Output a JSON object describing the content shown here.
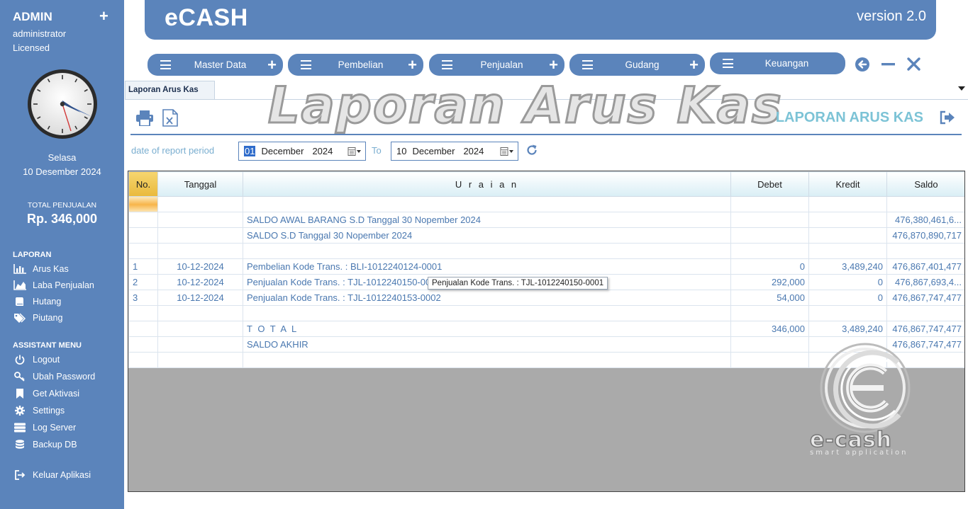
{
  "sidebar": {
    "admin": "ADMIN",
    "user": "administrator",
    "license": "Licensed",
    "day": "Selasa",
    "date": "10 Desember 2024",
    "total_label": "TOTAL PENJUALAN",
    "total_value": "Rp. 346,000",
    "laporan_title": "LAPORAN",
    "laporan_items": [
      "Arus Kas",
      "Laba Penjualan",
      "Hutang",
      "Piutang"
    ],
    "assistant_title": "ASSISTANT MENU",
    "assistant_items": [
      "Logout",
      "Ubah Password",
      "Get Aktivasi",
      "Settings",
      "Log Server",
      "Backup DB"
    ],
    "exit": "Keluar Aplikasi"
  },
  "header": {
    "title": "eCASH",
    "version": "version 2.0"
  },
  "menu": [
    "Master Data",
    "Pembelian",
    "Penjualan",
    "Gudang",
    "Keuangan"
  ],
  "tab": {
    "label": "Laporan Arus Kas"
  },
  "watermark": "Laporan Arus Kas",
  "report": {
    "title": "LAPORAN ARUS KAS"
  },
  "period": {
    "label": "date of report period",
    "to": "To",
    "from": {
      "day": "01",
      "month": "December",
      "year": "2024"
    },
    "until": {
      "day": "10",
      "month": "December",
      "year": "2024"
    }
  },
  "table": {
    "headers": [
      "No.",
      "Tanggal",
      "U r a i a n",
      "Debet",
      "Kredit",
      "Saldo"
    ],
    "rows": [
      {
        "no": "",
        "date": "",
        "desc": "",
        "debet": "",
        "kredit": "",
        "saldo": ""
      },
      {
        "no": "",
        "date": "",
        "desc": "SALDO AWAL BARANG S.D Tanggal 30 Nopember 2024",
        "debet": "",
        "kredit": "",
        "saldo": "476,380,461,6..."
      },
      {
        "no": "",
        "date": "",
        "desc": "SALDO S.D Tanggal 30 Nopember 2024",
        "debet": "",
        "kredit": "",
        "saldo": "476,870,890,717"
      },
      {
        "no": "",
        "date": "",
        "desc": "",
        "debet": "",
        "kredit": "",
        "saldo": ""
      },
      {
        "no": "1",
        "date": "10-12-2024",
        "desc": "Pembelian Kode Trans. : BLI-1012240124-0001",
        "debet": "0",
        "kredit": "3,489,240",
        "saldo": "476,867,401,477"
      },
      {
        "no": "2",
        "date": "10-12-2024",
        "desc": "Penjualan Kode Trans. : TJL-1012240150-0001",
        "debet": "292,000",
        "kredit": "0",
        "saldo": "476,867,693,4..."
      },
      {
        "no": "3",
        "date": "10-12-2024",
        "desc": "Penjualan Kode Trans. : TJL-1012240153-0002",
        "debet": "54,000",
        "kredit": "0",
        "saldo": "476,867,747,477"
      },
      {
        "no": "",
        "date": "",
        "desc": "",
        "debet": "",
        "kredit": "",
        "saldo": ""
      },
      {
        "no": "",
        "date": "",
        "desc": "T O T A L",
        "debet": "346,000",
        "kredit": "3,489,240",
        "saldo": "476,867,747,477"
      },
      {
        "no": "",
        "date": "",
        "desc": "SALDO AKHIR",
        "debet": "",
        "kredit": "",
        "saldo": "476,867,747,477"
      },
      {
        "no": "",
        "date": "",
        "desc": "",
        "debet": "",
        "kredit": "",
        "saldo": ""
      }
    ]
  },
  "tooltip": "Penjualan Kode Trans. : TJL-1012240150-0001",
  "logo": {
    "name": "e-cash",
    "tagline": "smart application"
  },
  "colors": {
    "primary": "#5b84bb",
    "accent": "#7cc3d6",
    "selection": "#f7b54a"
  }
}
